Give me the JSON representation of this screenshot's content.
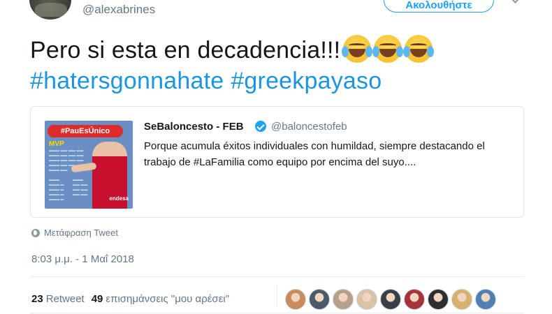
{
  "header": {
    "handle": "@alexabrines",
    "follow_label": "Ακολουθήστε"
  },
  "tweet": {
    "text": "Pero si esta en decadencia!!!",
    "emoji": [
      "face-with-tears-of-joy",
      "face-with-tears-of-joy",
      "face-with-tears-of-joy"
    ],
    "hashtags": [
      "#hatersgonnahate",
      "#greekpayaso"
    ]
  },
  "quoted_tweet": {
    "name": "SeBaloncesto - FEB",
    "handle": "@baloncestofeb",
    "text": "Porque acumula éxitos individuales con humildad, siempre destacando el trabajo de #LaFamilia como equipo por encima del suyo....",
    "image": {
      "banner": "#PauEsÚnico",
      "mvp": "MVP",
      "sponsor": "endesa"
    }
  },
  "translate_label": "Μετάφραση Tweet",
  "timestamp": "8:03 μ.μ. - 1 Μαΐ 2018",
  "stats": {
    "retweets_count": "23",
    "retweets_label": "Retweet",
    "likes_count": "49",
    "likes_label": "επισημάνσεις \"μου αρέσει\""
  },
  "likers": [
    {
      "name": "liker-avatar-1",
      "color": "#c98a5e"
    },
    {
      "name": "liker-avatar-2",
      "color": "#4b5a6a"
    },
    {
      "name": "liker-avatar-3",
      "color": "#b7a08a"
    },
    {
      "name": "liker-avatar-4",
      "color": "#d9c2a5"
    },
    {
      "name": "liker-avatar-5",
      "color": "#3a4048"
    },
    {
      "name": "liker-avatar-6",
      "color": "#a8323a"
    },
    {
      "name": "liker-avatar-7",
      "color": "#2d2f33"
    },
    {
      "name": "liker-avatar-8",
      "color": "#d8b070"
    },
    {
      "name": "liker-avatar-9",
      "color": "#4f7fb3"
    }
  ],
  "colors": {
    "accent": "#1da1f2",
    "hashtag": "#1b95e0",
    "muted": "#657786"
  }
}
